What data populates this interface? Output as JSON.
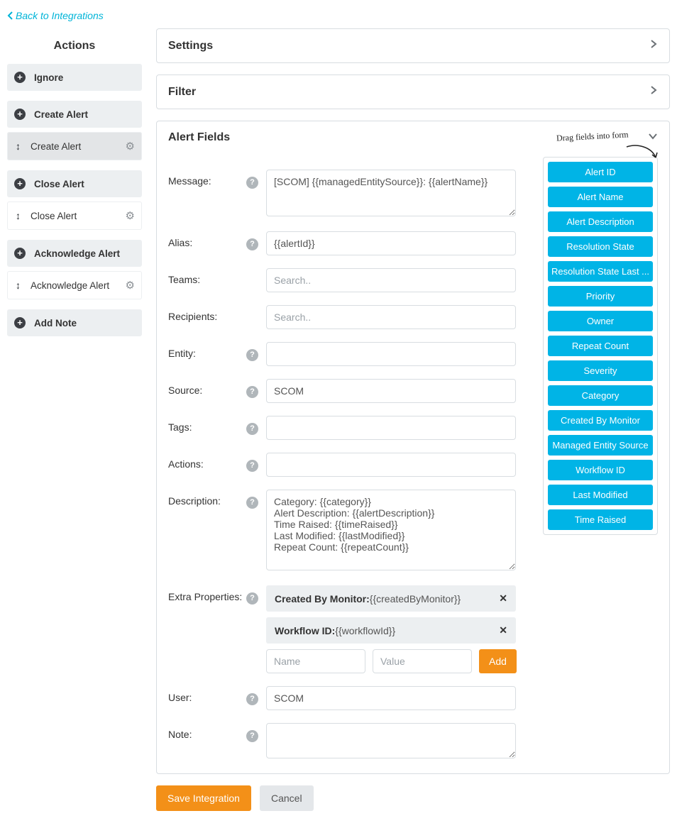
{
  "backLink": "Back to Integrations",
  "sidebar": {
    "title": "Actions",
    "groups": [
      {
        "label": "Ignore",
        "children": []
      },
      {
        "label": "Create Alert",
        "children": [
          {
            "label": "Create Alert",
            "selected": true
          }
        ]
      },
      {
        "label": "Close Alert",
        "children": [
          {
            "label": "Close Alert",
            "selected": false
          }
        ]
      },
      {
        "label": "Acknowledge Alert",
        "children": [
          {
            "label": "Acknowledge Alert",
            "selected": false
          }
        ]
      },
      {
        "label": "Add Note",
        "children": []
      }
    ]
  },
  "panels": {
    "settings": {
      "title": "Settings"
    },
    "filter": {
      "title": "Filter"
    },
    "alertFields": {
      "title": "Alert Fields",
      "dragHint": "Drag fields into form",
      "fields": {
        "message": {
          "label": "Message:",
          "value": "[SCOM] {{managedEntitySource}}: {{alertName}}"
        },
        "alias": {
          "label": "Alias:",
          "value": "{{alertId}}"
        },
        "teams": {
          "label": "Teams:",
          "placeholder": "Search.."
        },
        "recipients": {
          "label": "Recipients:",
          "placeholder": "Search.."
        },
        "entity": {
          "label": "Entity:",
          "value": ""
        },
        "source": {
          "label": "Source:",
          "value": "SCOM"
        },
        "tags": {
          "label": "Tags:",
          "value": ""
        },
        "actions": {
          "label": "Actions:",
          "value": ""
        },
        "description": {
          "label": "Description:",
          "value": "Category: {{category}}\nAlert Description: {{alertDescription}}\nTime Raised: {{timeRaised}}\nLast Modified: {{lastModified}}\nRepeat Count: {{repeatCount}}"
        },
        "extra": {
          "label": "Extra Properties:",
          "rows": [
            {
              "key": "Created By Monitor:",
              "val": "{{createdByMonitor}}"
            },
            {
              "key": "Workflow ID:",
              "val": "{{workflowId}}"
            }
          ],
          "namePh": "Name",
          "valuePh": "Value",
          "addLabel": "Add"
        },
        "user": {
          "label": "User:",
          "value": "SCOM"
        },
        "note": {
          "label": "Note:",
          "value": ""
        }
      },
      "palette": [
        "Alert ID",
        "Alert Name",
        "Alert Description",
        "Resolution State",
        "Resolution State Last ...",
        "Priority",
        "Owner",
        "Repeat Count",
        "Severity",
        "Category",
        "Created By Monitor",
        "Managed Entity Source",
        "Workflow ID",
        "Last Modified",
        "Time Raised"
      ]
    }
  },
  "footer": {
    "save": "Save Integration",
    "cancel": "Cancel"
  }
}
